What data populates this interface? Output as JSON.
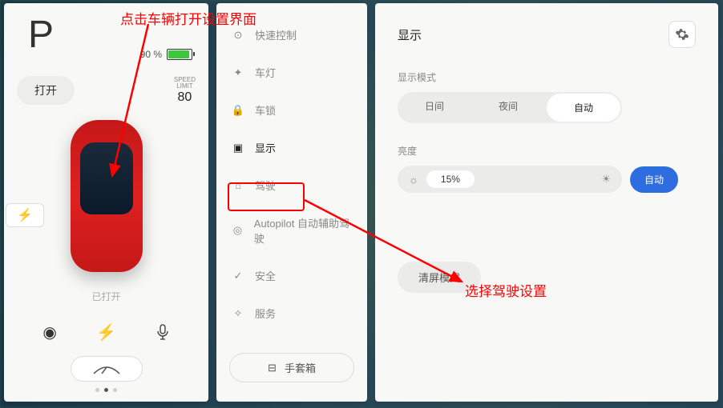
{
  "left": {
    "gear": "P",
    "battery_pct": "90 %",
    "open_button": "打开",
    "speed_limit_label": "SPEED\nLIMIT",
    "speed_limit_value": "80",
    "status": "已打开"
  },
  "nav": {
    "items": [
      {
        "label": "快速控制",
        "icon": "⊙"
      },
      {
        "label": "车灯",
        "icon": "✦"
      },
      {
        "label": "车锁",
        "icon": "🔒"
      },
      {
        "label": "显示",
        "icon": "▣"
      },
      {
        "label": "驾驶",
        "icon": "⌂"
      },
      {
        "label": "Autopilot 自动辅助驾驶",
        "icon": "◎"
      },
      {
        "label": "安全",
        "icon": "✓"
      },
      {
        "label": "服务",
        "icon": "✧"
      }
    ],
    "glovebox": "手套箱"
  },
  "right": {
    "title": "显示",
    "display_mode_label": "显示模式",
    "modes": [
      "日间",
      "夜间",
      "自动"
    ],
    "mode_selected": 2,
    "brightness_label": "亮度",
    "brightness_value": "15%",
    "auto_label": "自动",
    "clear_screen": "清屏模式"
  },
  "annotations": {
    "top": "点击车辆打开设置界面",
    "bottom": "选择驾驶设置"
  }
}
